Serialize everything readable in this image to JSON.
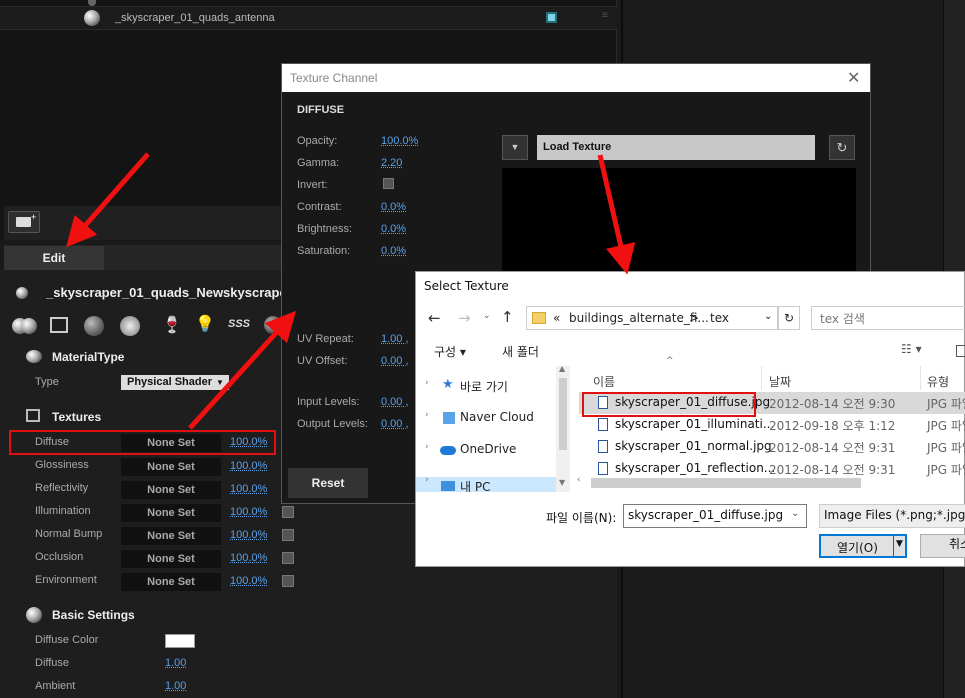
{
  "layer_panel": {
    "item_name": "_skyscraper_01_quads_antenna"
  },
  "material_editor": {
    "edit_tab": "Edit",
    "material_name": "_skyscraper_01_quads_Newskyscrape",
    "material_type_header": "MaterialType",
    "type_label": "Type",
    "type_value": "Physical Shader",
    "textures_header": "Textures",
    "textures": [
      {
        "label": "Diffuse",
        "value": "None Set",
        "percent": "100.0%"
      },
      {
        "label": "Glossiness",
        "value": "None Set",
        "percent": "100.0%"
      },
      {
        "label": "Reflectivity",
        "value": "None Set",
        "percent": "100.0%"
      },
      {
        "label": "Illumination",
        "value": "None Set",
        "percent": "100.0%"
      },
      {
        "label": "Normal Bump",
        "value": "None Set",
        "percent": "100.0%"
      },
      {
        "label": "Occlusion",
        "value": "None Set",
        "percent": "100.0%"
      },
      {
        "label": "Environment",
        "value": "None Set",
        "percent": "100.0%"
      }
    ],
    "basic_header": "Basic Settings",
    "basic": [
      {
        "label": "Diffuse Color",
        "value": ""
      },
      {
        "label": "Diffuse",
        "value": "1.00"
      },
      {
        "label": "Ambient",
        "value": "1.00"
      }
    ]
  },
  "texture_channel": {
    "title": "Texture Channel",
    "channel": "DIFFUSE",
    "params": [
      {
        "label": "Opacity:",
        "value": "100.0%"
      },
      {
        "label": "Gamma:",
        "value": "2.20"
      },
      {
        "label": "Invert:",
        "value": ""
      },
      {
        "label": "Contrast:",
        "value": "0.0%"
      },
      {
        "label": "Brightness:",
        "value": "0.0%"
      },
      {
        "label": "Saturation:",
        "value": "0.0%"
      }
    ],
    "params2": [
      {
        "label": "UV Repeat:",
        "value": "1.00 ,"
      },
      {
        "label": "UV Offset:",
        "value": "0.00 ,"
      },
      {
        "label": "Input Levels:",
        "value": "0.00 ,"
      },
      {
        "label": "Output Levels:",
        "value": "0.00 ,"
      }
    ],
    "load_texture": "Load Texture",
    "reset": "Reset"
  },
  "select_texture": {
    "title": "Select Texture",
    "path_prefix": "«",
    "path_1": "buildings_alternate_fi...",
    "path_sep": ">",
    "path_2": "tex",
    "search_placeholder": "tex 검색",
    "organize": "구성 ▾",
    "new_folder": "새 폴더",
    "nav": [
      "바로 가기",
      "Naver Cloud",
      "OneDrive",
      "내 PC"
    ],
    "columns": {
      "name": "이름",
      "date": "날짜",
      "type": "유형"
    },
    "files": [
      {
        "name": "skyscraper_01_diffuse.jpg",
        "date": "2012-08-14 오전 9:30",
        "type": "JPG 파일"
      },
      {
        "name": "skyscraper_01_illuminati...",
        "date": "2012-09-18 오후 1:12",
        "type": "JPG 파일"
      },
      {
        "name": "skyscraper_01_normal.jpg",
        "date": "2012-08-14 오전 9:31",
        "type": "JPG 파일"
      },
      {
        "name": "skyscraper_01_reflection...",
        "date": "2012-08-14 오전 9:31",
        "type": "JPG 파일"
      }
    ],
    "filename_label": "파일 이름(N):",
    "filename_value": "skyscraper_01_diffuse.jpg",
    "filetype_value": "Image Files (*.png;*.jpg;*.e",
    "open": "열기(O)",
    "cancel": "취소"
  }
}
